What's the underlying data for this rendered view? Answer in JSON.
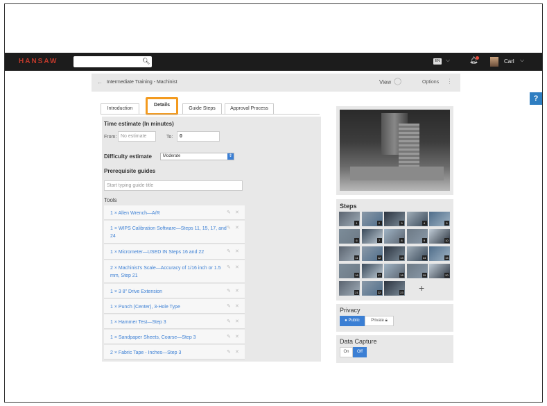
{
  "app": {
    "logo": "HANSAW"
  },
  "topbar": {
    "search_icon": "search-icon",
    "lang": "EN",
    "user_name": "Carl"
  },
  "breadcrumb": {
    "title": "Intermediate Training - Machinist",
    "view_label": "View",
    "options_label": "Options"
  },
  "help": {
    "label": "?"
  },
  "tabs": [
    {
      "label": "Introduction"
    },
    {
      "label": "Details",
      "active": true
    },
    {
      "label": "Guide Steps"
    },
    {
      "label": "Approval Process"
    }
  ],
  "details": {
    "time_label": "Time estimate (In minutes)",
    "from_label": "From:",
    "from_placeholder": "No estimate",
    "to_label": "To:",
    "to_value": "0",
    "difficulty_label": "Difficulty estimate",
    "difficulty_value": "Moderate",
    "prereq_label": "Prerequisite guides",
    "prereq_placeholder": "Start typing guide title",
    "tools_label": "Tools",
    "tools": [
      {
        "text": "1 × Allen Wrench—A/R"
      },
      {
        "text": "1 × WIPS Calibration Software—Steps 11, 15, 17, and 24"
      },
      {
        "text": "1 × Micrometer—USED IN Steps 16 and 22"
      },
      {
        "text": "2 × Machinist's Scale—Accuracy of 1/16 inch or 1.5 mm, Step 21"
      },
      {
        "text": "1 × 3 8\" Drive Extension"
      },
      {
        "text": "1 × Punch (Center), 3-Hole Type"
      },
      {
        "text": "1 × Hammer Test—Step 3"
      },
      {
        "text": "1 × Sandpaper Sheets, Coarse—Step 3"
      },
      {
        "text": "2 × Fabric Tape - Inches—Step 3"
      }
    ]
  },
  "steps": {
    "label": "Steps",
    "numbers": [
      "1",
      "2",
      "3",
      "4",
      "5",
      "6",
      "7",
      "8",
      "9",
      "10",
      "11",
      "12",
      "13",
      "14",
      "15",
      "16",
      "17",
      "18",
      "19",
      "20",
      "21",
      "22",
      "23"
    ],
    "add": "+"
  },
  "privacy": {
    "label": "Privacy",
    "public": "Public",
    "private": "Private"
  },
  "data_capture": {
    "label": "Data Capture",
    "on": "On",
    "off": "Off"
  }
}
